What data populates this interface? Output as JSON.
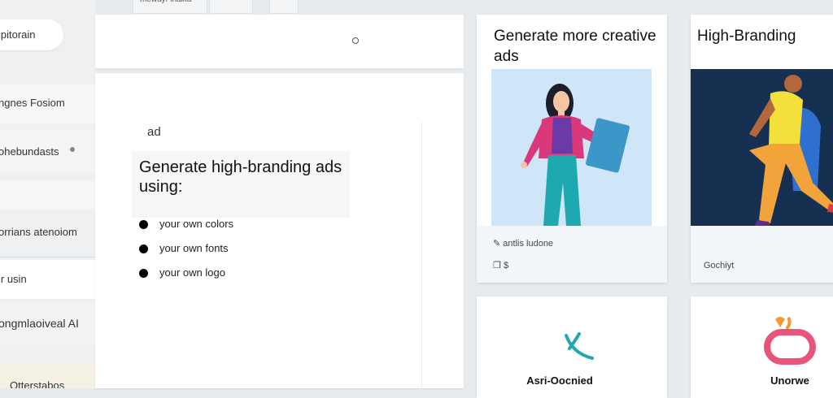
{
  "top_strip": {
    "tab1": "mewayi-inaika"
  },
  "sidebar": {
    "pill_label": "ipitorain",
    "items": [
      {
        "label": "ngnes Fosiom"
      },
      {
        "label": "ohebundasts"
      },
      {
        "label": ""
      },
      {
        "label": "orrians atenoiom"
      },
      {
        "label": "ir usin"
      },
      {
        "label": "ongmlaoiveal AI"
      },
      {
        "label": "Otterstabos"
      }
    ]
  },
  "main": {
    "ad_label": "ad",
    "heading": "Generate high-branding ads using:",
    "bullets": [
      "your own colors",
      "your own fonts",
      "your own logo"
    ]
  },
  "cards": [
    {
      "title": "Generate more creative ads",
      "meta1": "antlis ludone",
      "meta2": "$",
      "illustration": "woman-holding-card"
    },
    {
      "title": "High-Branding",
      "meta1": "Gochiyt",
      "illustration": "jumping-figure"
    },
    {
      "brand": "Asri-Oocnied",
      "logo": "teal-swoosh-logo"
    },
    {
      "brand": "Unorwe",
      "logo": "pink-ring-logo"
    }
  ],
  "colors": {
    "teal": "#1fa7b3",
    "navy": "#163052",
    "pink": "#e8557a",
    "orange": "#f29a2e",
    "light_blue": "#cfe6f8"
  }
}
